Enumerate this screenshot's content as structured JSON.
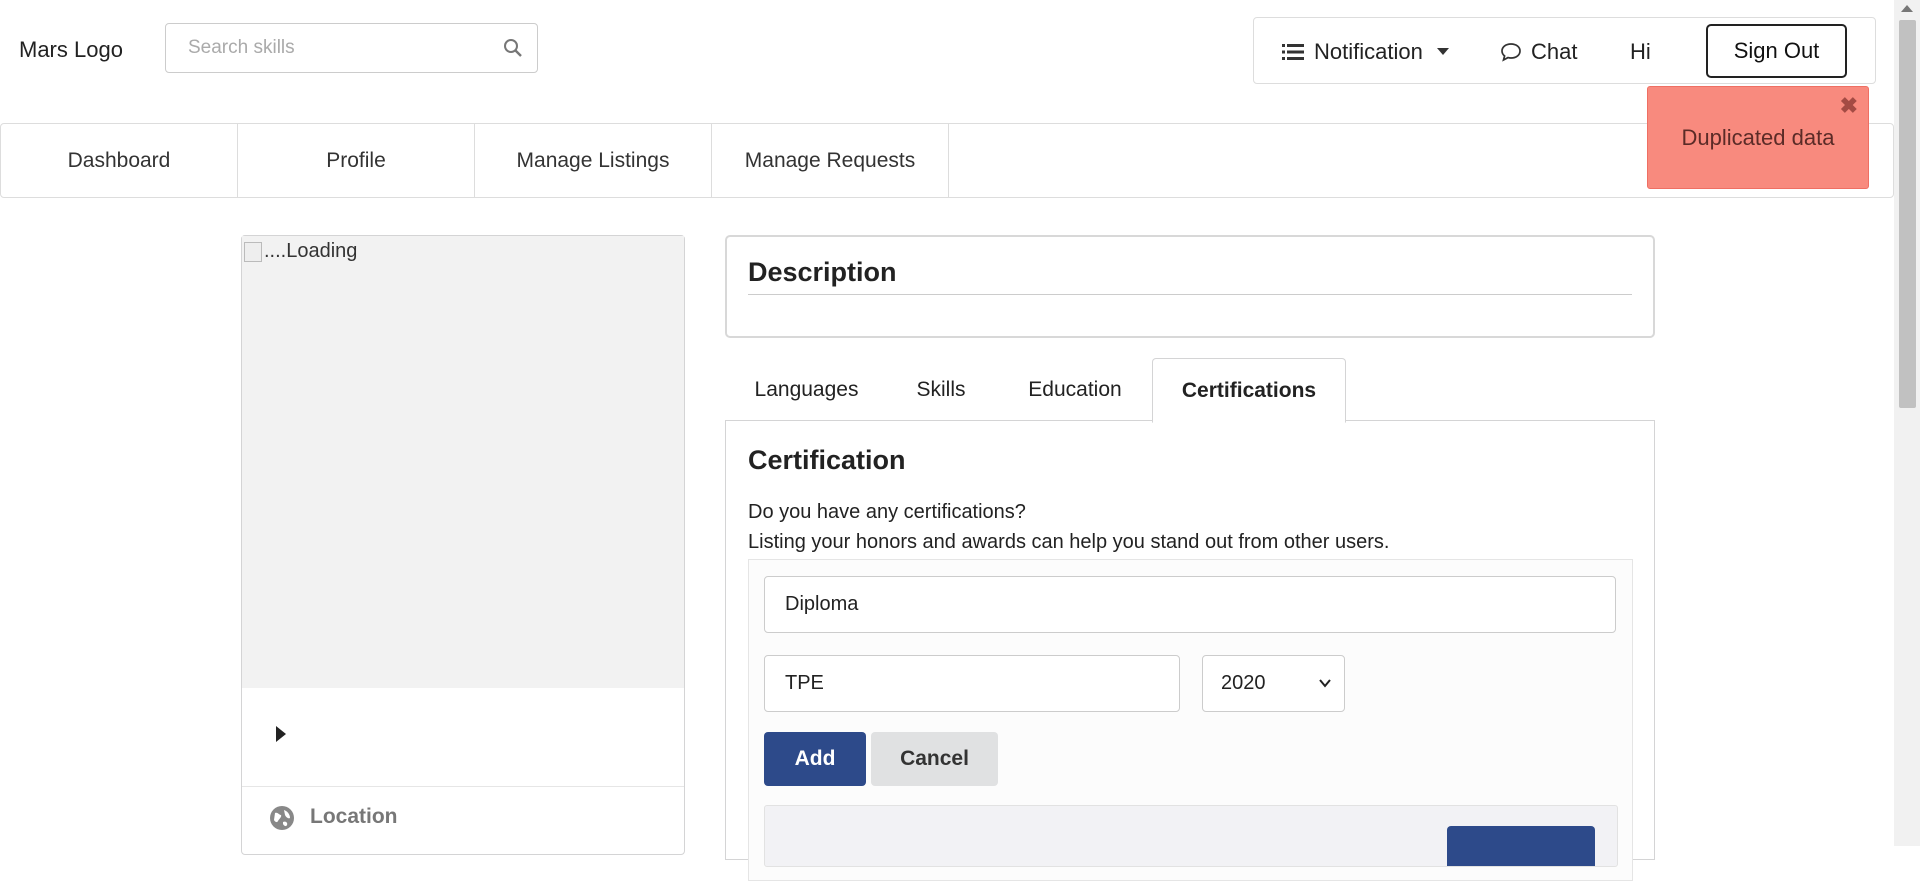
{
  "header": {
    "logo_text": "Mars Logo",
    "search_placeholder": "Search skills",
    "menu": {
      "notification_label": "Notification",
      "chat_label": "Chat",
      "greeting": "Hi",
      "signout_label": "Sign Out"
    }
  },
  "nav": {
    "items": [
      {
        "label": "Dashboard"
      },
      {
        "label": "Profile"
      },
      {
        "label": "Manage Listings"
      },
      {
        "label": "Manage Requests"
      }
    ]
  },
  "toast": {
    "message": "Duplicated data",
    "close_glyph": "✖",
    "background_color": "#f88a7e"
  },
  "profile_card": {
    "image_alt": "....Loading",
    "location_label": "Location"
  },
  "description": {
    "title": "Description"
  },
  "tabs": {
    "items": [
      {
        "label": "Languages"
      },
      {
        "label": "Skills"
      },
      {
        "label": "Education"
      },
      {
        "label": "Certifications"
      }
    ],
    "active": "Certifications"
  },
  "certification": {
    "title": "Certification",
    "desc_line1": "Do you have any certifications?",
    "desc_line2": "Listing your honors and awards can help you stand out from other users.",
    "form": {
      "certificate_value": "Diploma",
      "from_value": "TPE",
      "year_value": "2020",
      "add_label": "Add",
      "cancel_label": "Cancel"
    }
  },
  "colors": {
    "primary_button": "#2d4a8a",
    "toast_bg": "#f88a7e"
  }
}
